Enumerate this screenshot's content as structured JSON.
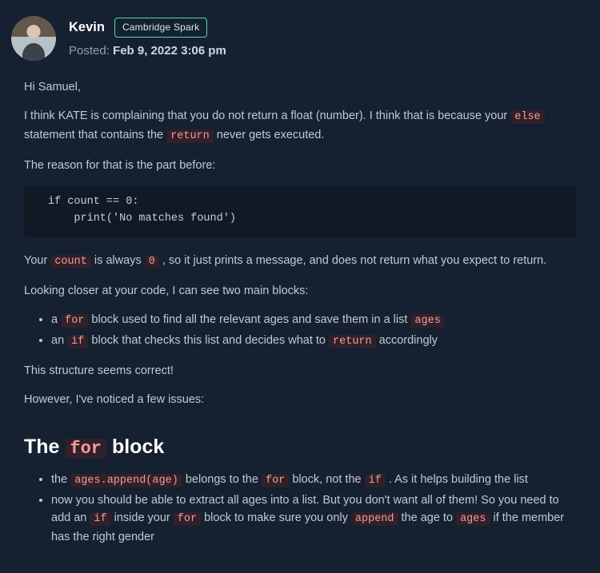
{
  "header": {
    "author": "Kevin",
    "badge": "Cambridge Spark",
    "posted_prefix": "Posted: ",
    "timestamp": "Feb 9, 2022 3:06 pm"
  },
  "body": {
    "greeting": "Hi Samuel,",
    "p1_a": "I think KATE is complaining that you do not return a float (number). I think that is because your ",
    "p1_code1": "else",
    "p1_b": " statement that contains the ",
    "p1_code2": "return",
    "p1_c": " never gets executed.",
    "p2": "The reason for that is the part before:",
    "code_block": "if count == 0:\n    print('No matches found')",
    "p3_a": "Your ",
    "p3_code1": "count",
    "p3_b": " is always ",
    "p3_code2": "0",
    "p3_c": " , so it just prints a message, and does not return what you expect to return.",
    "p4": "Looking closer at your code, I can see two main blocks:",
    "blocks": {
      "b1_a": "a ",
      "b1_code1": "for",
      "b1_b": " block used to find all the relevant ages and save them in a list ",
      "b1_code2": "ages",
      "b2_a": "an ",
      "b2_code1": "if",
      "b2_b": " block that checks this list and decides what to ",
      "b2_code2": "return",
      "b2_c": " accordingly"
    },
    "p5": "This structure seems correct!",
    "p6": "However, I've noticed a few issues:",
    "h2_a": "The ",
    "h2_code": "for",
    "h2_b": " block",
    "for_block": {
      "li1_a": "the ",
      "li1_code1": "ages.append(age)",
      "li1_b": " belongs to the ",
      "li1_code2": "for",
      "li1_c": " block, not the ",
      "li1_code3": "if",
      "li1_d": " . As it helps building the list",
      "li2_a": "now you should be able to extract all ages into a list. But you don't want all of them! So you need to add an ",
      "li2_code1": "if",
      "li2_b": " inside your ",
      "li2_code2": "for",
      "li2_c": " block to make sure you only ",
      "li2_code3": "append",
      "li2_d": " the age to ",
      "li2_code4": "ages",
      "li2_e": " if the member has the right gender"
    }
  }
}
